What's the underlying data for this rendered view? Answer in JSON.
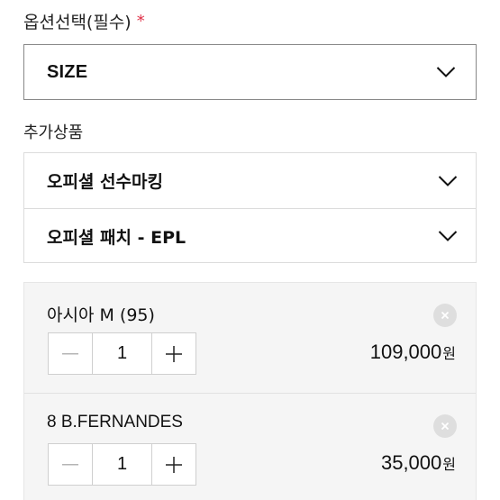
{
  "option": {
    "label": "옵션선택(필수)",
    "required_mark": "*"
  },
  "size_select": {
    "value": "SIZE",
    "icon": "chevron-down-icon"
  },
  "extra": {
    "label": "추가상품",
    "items": [
      {
        "label": "오피셜 선수마킹",
        "icon": "chevron-down-icon"
      },
      {
        "label": "오피셜 패치 - EPL",
        "icon": "chevron-down-icon"
      }
    ]
  },
  "cart": {
    "items": [
      {
        "name": "아시아 M (95)",
        "quantity": "1",
        "price": "109,000",
        "currency": "원"
      },
      {
        "name": "8 B.FERNANDES",
        "quantity": "1",
        "price": "35,000",
        "currency": "원"
      }
    ]
  },
  "colors": {
    "required": "#e0334a",
    "border": "#888888",
    "panel": "#f5f5f5"
  }
}
